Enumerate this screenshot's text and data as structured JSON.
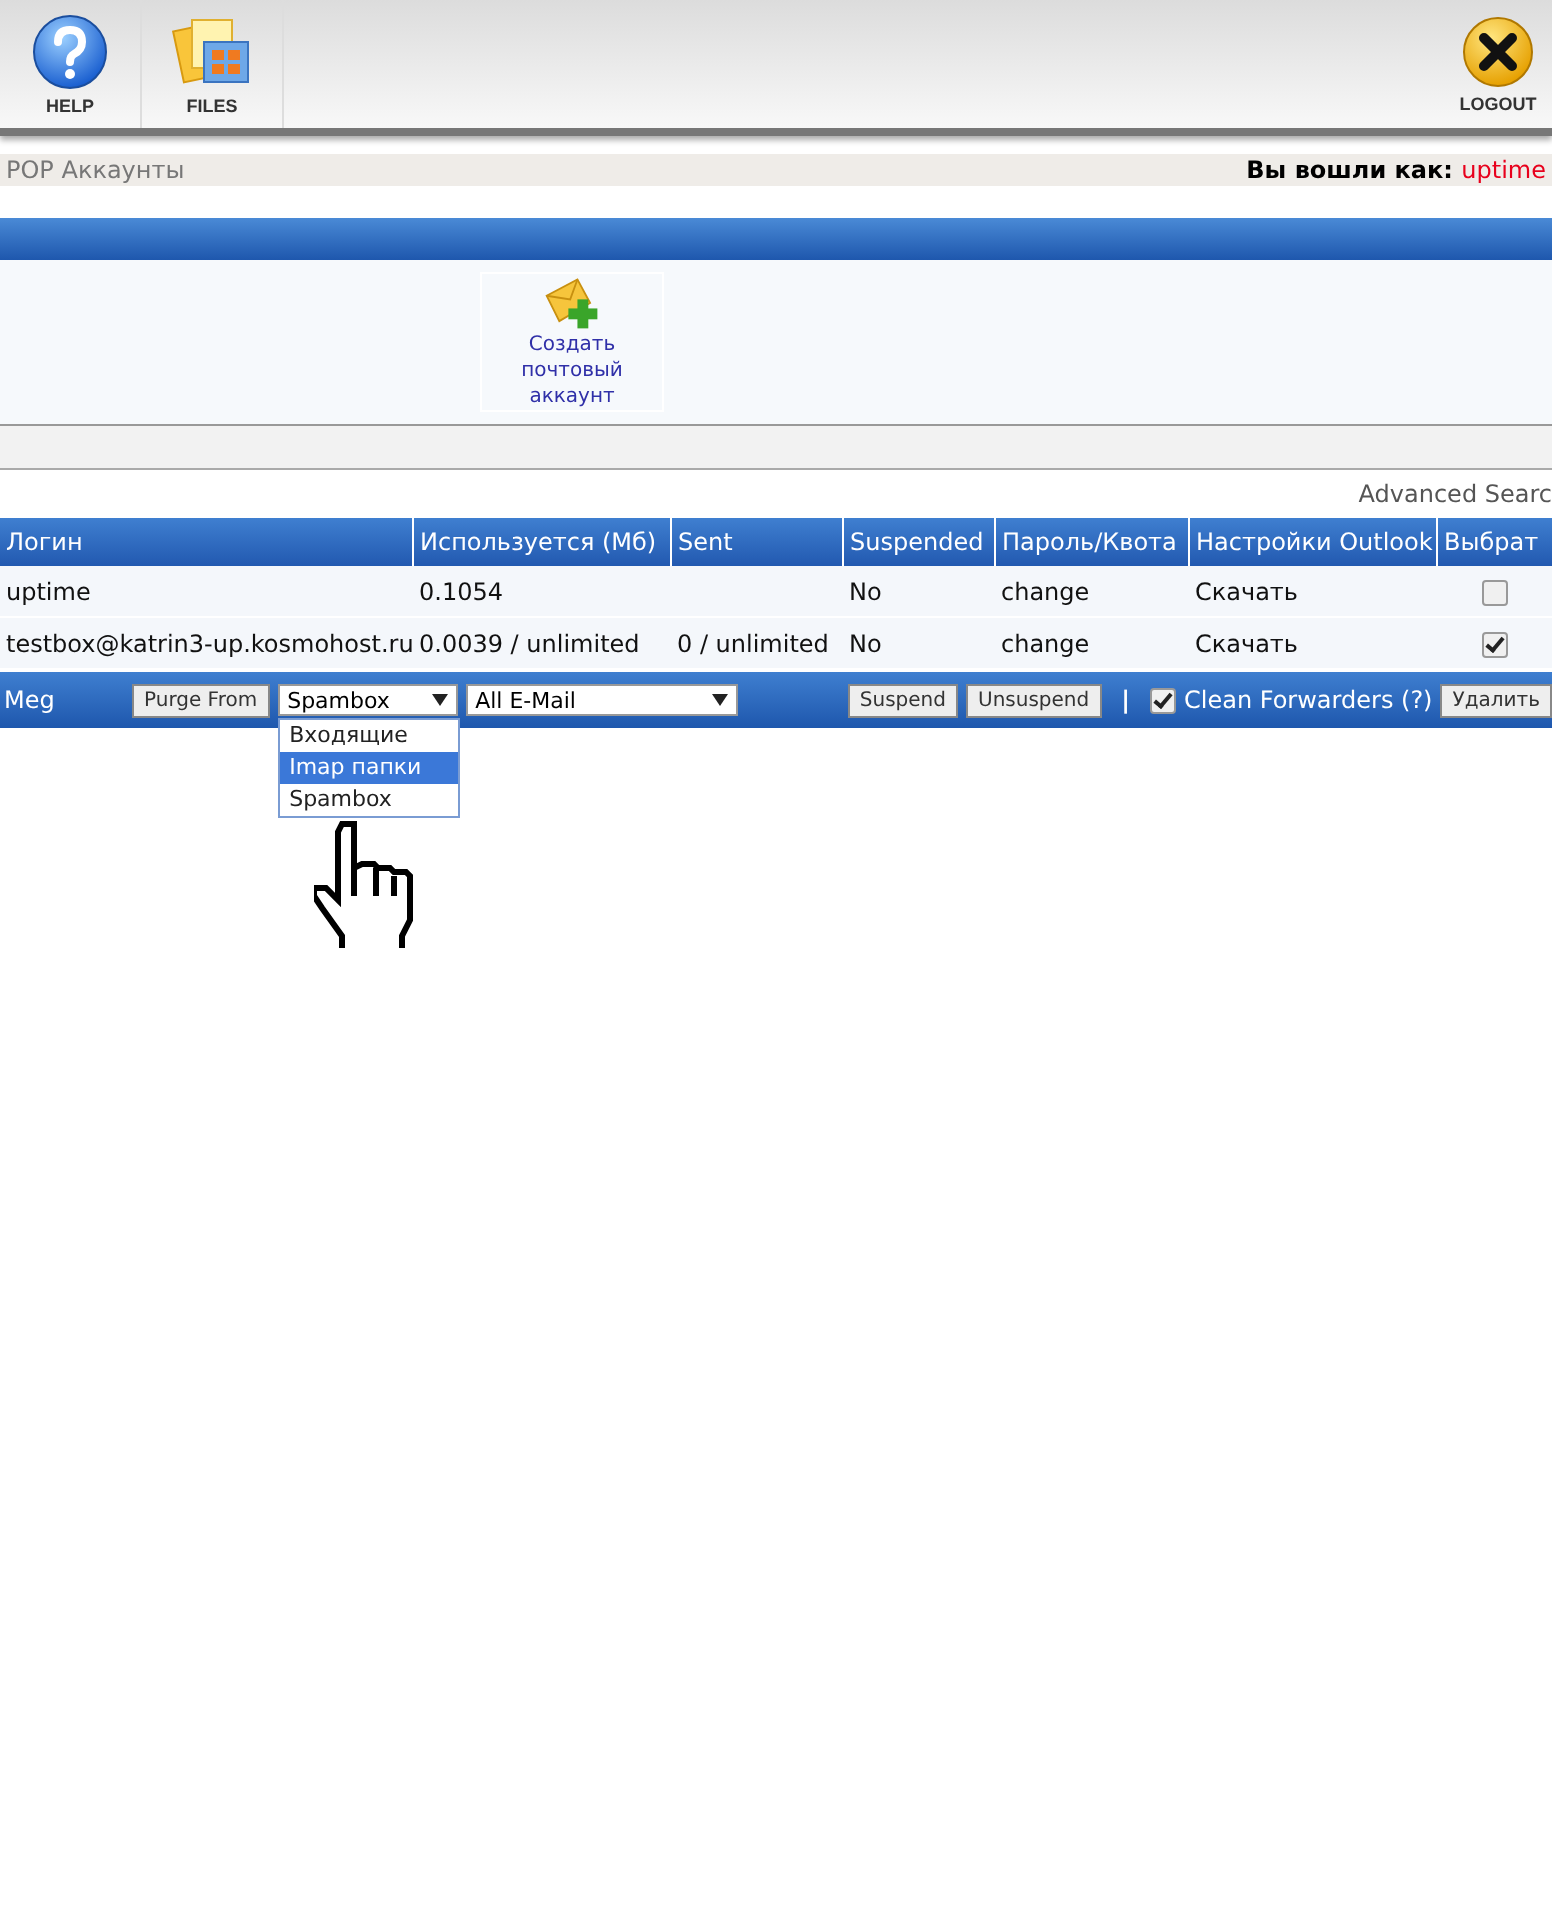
{
  "toolbar": {
    "items": [
      {
        "kind": "help",
        "label": "HELP"
      },
      {
        "kind": "files",
        "label": "FILES"
      }
    ],
    "logout": {
      "label": "LOGOUT"
    }
  },
  "breadcrumb": {
    "title": "POP Аккаунты",
    "login_label": "Вы вошли как:",
    "login_user": "uptime"
  },
  "actions": [
    {
      "label": "Создать почтовый аккаунт"
    }
  ],
  "advanced_search": "Advanced Searc",
  "table": {
    "columns": [
      "Логин",
      "Используется (Мб)",
      "Sent",
      "Suspended",
      "Пароль/Квота",
      "Настройки Outlook",
      "Выбрат"
    ],
    "rows": [
      {
        "cells": [
          "uptime",
          "0.1054",
          "",
          "No",
          "change",
          "Скачать"
        ],
        "checked": false
      },
      {
        "cells": [
          "testbox@katrin3-up.kosmohost.ru",
          "0.0039 / unlimited",
          "0 / unlimited",
          "No",
          "change",
          "Скачать"
        ],
        "checked": true
      }
    ]
  },
  "footer": {
    "label": "Meg",
    "purge_button": "Purge From",
    "folder_select": {
      "value": "Spambox",
      "options": [
        {
          "label": "Входящие",
          "highlighted": false
        },
        {
          "label": "Imap папки",
          "highlighted": true
        },
        {
          "label": "Spambox",
          "highlighted": false
        }
      ]
    },
    "type_select": {
      "value": "All E-Mail"
    },
    "suspend_button": "Suspend",
    "unsuspend_button": "Unsuspend",
    "separator": "|",
    "clean_forwarders": {
      "label": "Clean Forwarders (?)",
      "checked": true
    },
    "delete_button": "Удалить"
  }
}
